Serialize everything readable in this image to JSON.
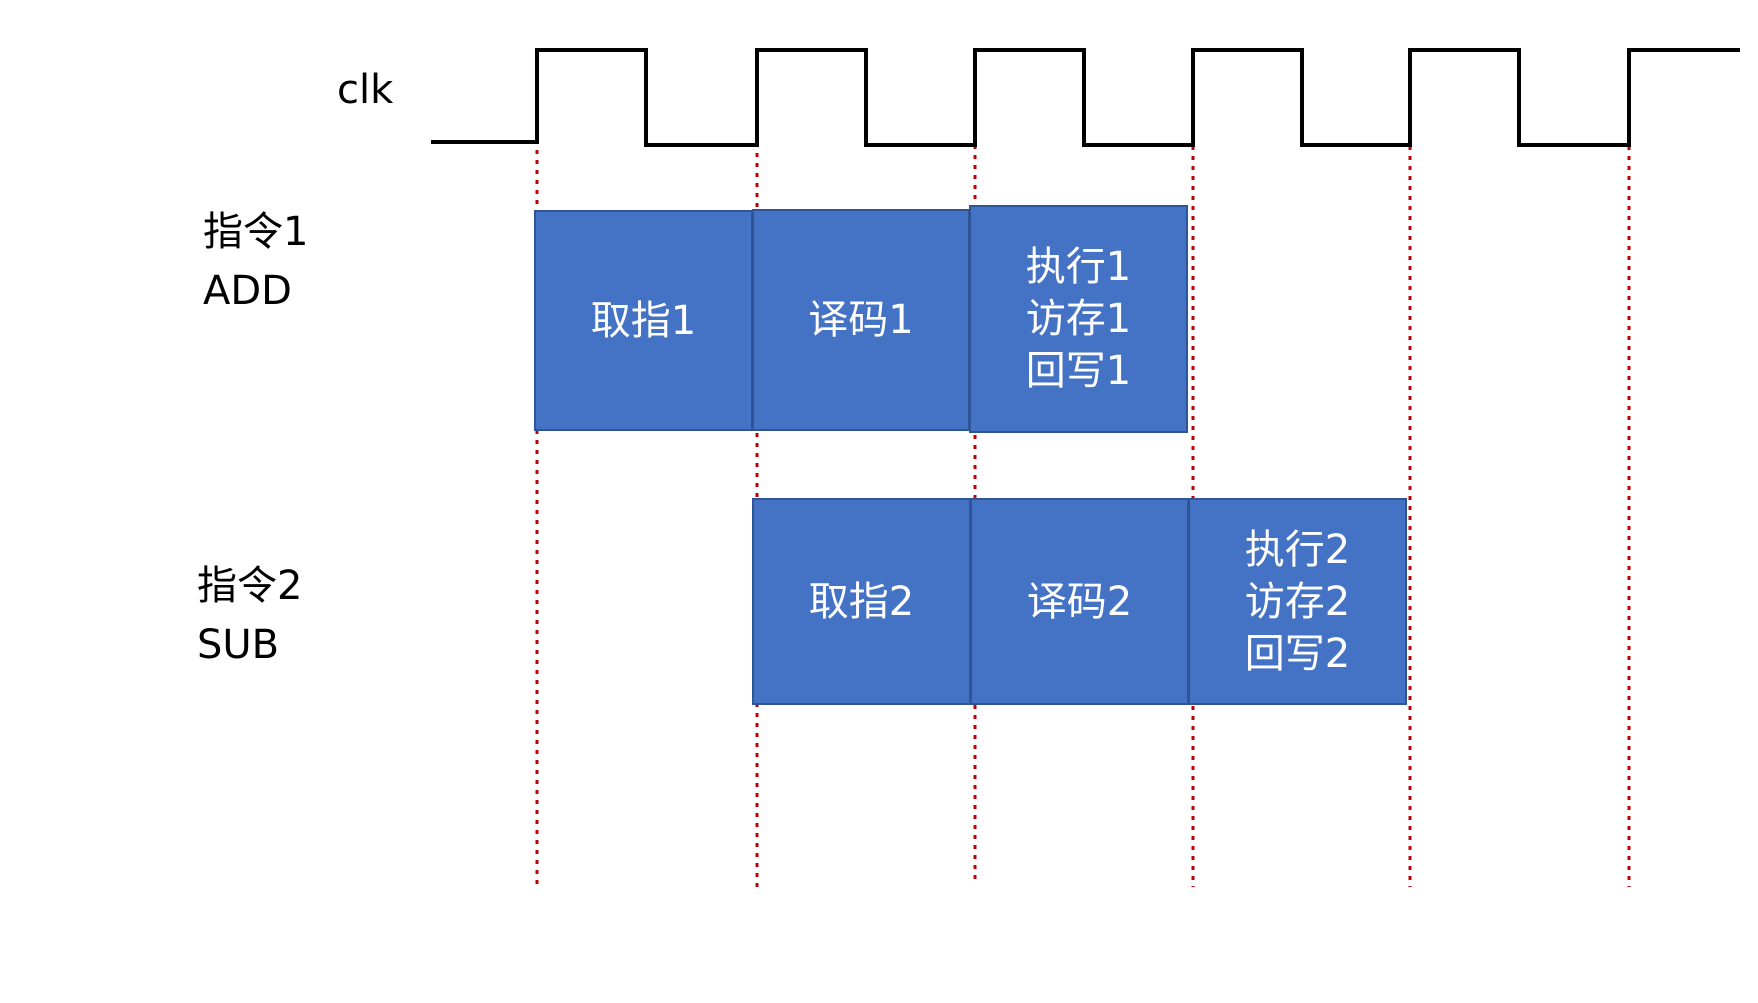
{
  "clock_label": "clk",
  "instructions": [
    {
      "name": "指令1",
      "op": "ADD",
      "stages": [
        [
          "取指1"
        ],
        [
          "译码1"
        ],
        [
          "执行1",
          "访存1",
          "回写1"
        ]
      ]
    },
    {
      "name": "指令2",
      "op": "SUB",
      "stages": [
        [
          "取指2"
        ],
        [
          "译码2"
        ],
        [
          "执行2",
          "访存2",
          "回写2"
        ]
      ]
    }
  ],
  "colors": {
    "stage_fill": "#4472c4",
    "stage_border": "#2f5597",
    "stage_text": "#ffffff",
    "guide_line": "#c00000",
    "clock": "#000000"
  }
}
